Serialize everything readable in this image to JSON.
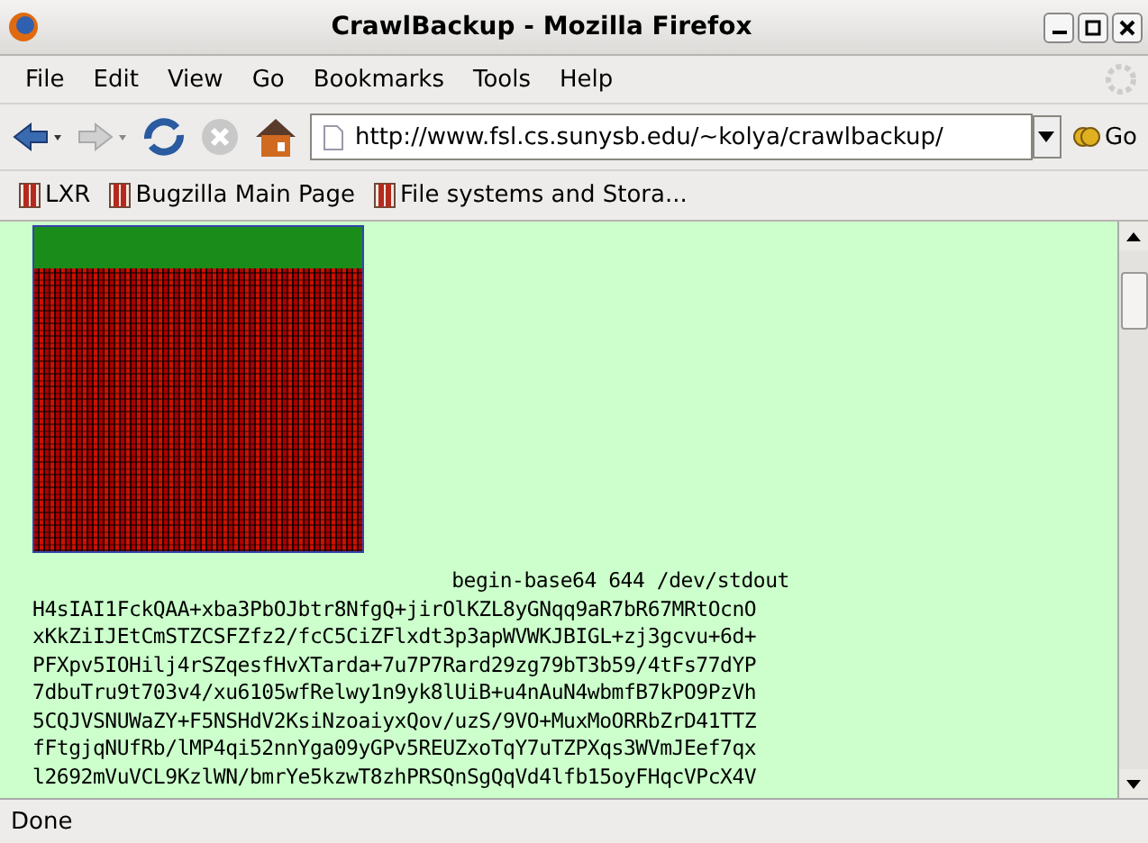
{
  "window": {
    "title": "CrawlBackup - Mozilla Firefox"
  },
  "menu": [
    "File",
    "Edit",
    "View",
    "Go",
    "Bookmarks",
    "Tools",
    "Help"
  ],
  "toolbar": {
    "url": "http://www.fsl.cs.sunysb.edu/~kolya/crawlbackup/",
    "go_label": "Go"
  },
  "bookmarks": [
    "LXR",
    "Bugzilla Main Page",
    "File systems and Stora..."
  ],
  "content": {
    "header": "begin-base64 644 /dev/stdout",
    "lines": [
      "H4sIAI1FckQAA+xba3PbOJbtr8NfgQ+jirOlKZL8yGNqq9aR7bR67MRtOcnO",
      "xKkZiIJEtCmSTZCSFZfz2/fcC5CiZFlxdt3p3apWVWKJBIGL+zj3gcvu+6d+",
      "PFXpv5IOHilj4rSZqesfHvXTarda+7u7P7Rard29zg79bT3b59/4tFs77dYP",
      "7dbuTru9t703v4/xu6105wfRelwy1n9yk8lUiB+u4nAuN4wbmfB7kPO9PzVh",
      "5CQJVSNUWaZY+F5NSHdV2KsiNzoaiyxQov/uzS/9VO+MuxMoORRbZrD41TTZ",
      "fFtgjqNUfRb/lMP4qi52nnYga09yGPv5REUZxoTqY7uTZPXqs3WVmJEef7qx",
      "l2692mVuVCL9KzlWN/bmrYe5kzwT8zhPRSQnSgQqVd4lfb15oyFHqcVPcX4V"
    ]
  },
  "status_bar": "Done"
}
